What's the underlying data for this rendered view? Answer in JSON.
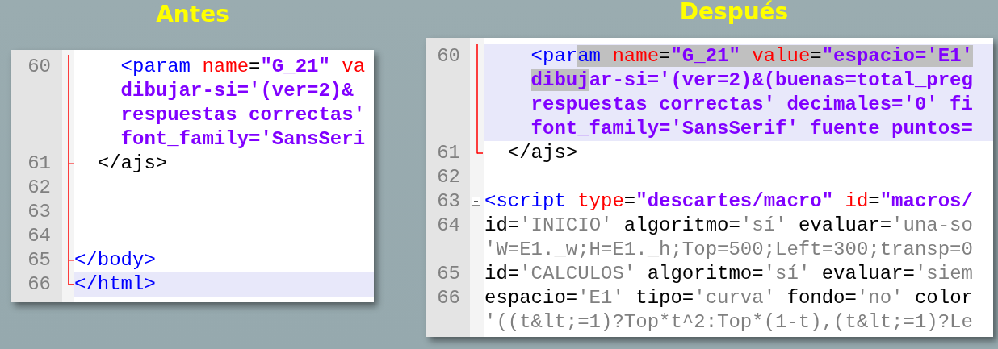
{
  "panels": [
    {
      "title": "Antes",
      "lines": [
        {
          "number": "60",
          "kind": "bar",
          "highlighted": false,
          "rows": [
            [
              {
                "kind": "tag",
                "text": "    <param ",
                "selected": false
              },
              {
                "kind": "attr",
                "text": "name",
                "selected": false
              },
              {
                "kind": "eq",
                "text": "=",
                "selected": false
              },
              {
                "kind": "string",
                "text": "\"G_21\"",
                "selected": false
              },
              {
                "kind": "attr",
                "text": " va",
                "selected": false
              }
            ],
            [
              {
                "kind": "string",
                "text": "    dibujar-si='(ver=2)&",
                "selected": false
              }
            ],
            [
              {
                "kind": "string",
                "text": "    respuestas correctas'",
                "selected": false
              }
            ],
            [
              {
                "kind": "string",
                "text": "    font_family='SansSeri",
                "selected": false
              }
            ]
          ]
        },
        {
          "number": "61",
          "kind": "tick",
          "highlighted": false,
          "rows": [
            [
              {
                "kind": "text",
                "text": "  </ajs>",
                "selected": false
              }
            ]
          ]
        },
        {
          "number": "62",
          "kind": "bar",
          "highlighted": false
        },
        {
          "number": "63",
          "kind": "bar",
          "highlighted": false
        },
        {
          "number": "64",
          "kind": "bar",
          "highlighted": false
        },
        {
          "number": "65",
          "kind": "tick",
          "highlighted": false,
          "rows": [
            [
              {
                "kind": "tag",
                "text": "</body>",
                "selected": false
              }
            ]
          ]
        },
        {
          "number": "66",
          "kind": "end",
          "highlighted": true,
          "rows": [
            [
              {
                "kind": "tag",
                "text": "</html>",
                "selected": false
              }
            ]
          ]
        }
      ]
    },
    {
      "title": "Después",
      "lines": [
        {
          "number": "60",
          "kind": "bar",
          "highlighted": true,
          "rows": [
            [
              {
                "kind": "tag",
                "text": "    <par",
                "selected": false
              },
              {
                "kind": "tag",
                "text": "am ",
                "selected": true
              },
              {
                "kind": "attr",
                "text": "name",
                "selected": true
              },
              {
                "kind": "eq",
                "text": "=",
                "selected": true
              },
              {
                "kind": "string",
                "text": "\"G_21\"",
                "selected": true
              },
              {
                "kind": "attr",
                "text": " value",
                "selected": true
              },
              {
                "kind": "eq",
                "text": "=",
                "selected": true
              },
              {
                "kind": "string",
                "text": "\"espacio='E1'",
                "selected": true
              }
            ],
            [
              {
                "kind": "string",
                "text": "    ",
                "selected": false
              },
              {
                "kind": "string",
                "text": "dibuj",
                "selected": true
              },
              {
                "kind": "string",
                "text": "ar-si='(ver=2)&(buenas=total_preg",
                "selected": false
              }
            ],
            [
              {
                "kind": "string",
                "text": "    respuestas correctas' decimales='0' fi",
                "selected": false
              }
            ],
            [
              {
                "kind": "string",
                "text": "    font_family='SansSerif' fuente puntos=",
                "selected": false
              }
            ]
          ]
        },
        {
          "number": "61",
          "kind": "end",
          "highlighted": false,
          "rows": [
            [
              {
                "kind": "text",
                "text": "  </ajs>",
                "selected": false
              }
            ]
          ]
        },
        {
          "number": "62",
          "kind": "plain",
          "highlighted": false
        },
        {
          "number": "63",
          "kind": "box",
          "highlighted": false,
          "rows": [
            [
              {
                "kind": "tag",
                "text": "<script ",
                "selected": false
              },
              {
                "kind": "attr",
                "text": "type",
                "selected": false
              },
              {
                "kind": "eq",
                "text": "=",
                "selected": false
              },
              {
                "kind": "string",
                "text": "\"descartes/macro\"",
                "selected": false
              },
              {
                "kind": "attr",
                "text": " id",
                "selected": false
              },
              {
                "kind": "eq",
                "text": "=",
                "selected": false
              },
              {
                "kind": "string",
                "text": "\"macros/",
                "selected": false
              }
            ]
          ]
        },
        {
          "number": "64",
          "kind": "plain",
          "highlighted": false,
          "rows": [
            [
              {
                "kind": "text",
                "text": "id=",
                "selected": false
              },
              {
                "kind": "value",
                "text": "'INICIO'",
                "selected": false
              },
              {
                "kind": "text",
                "text": " algoritmo=",
                "selected": false
              },
              {
                "kind": "value",
                "text": "'sí'",
                "selected": false
              },
              {
                "kind": "text",
                "text": " evaluar=",
                "selected": false
              },
              {
                "kind": "value",
                "text": "'una-so",
                "selected": false
              }
            ],
            [
              {
                "kind": "value",
                "text": "'W=E1._w;H=E1._h;Top=500;Left=300;transp=0",
                "selected": false
              }
            ]
          ]
        },
        {
          "number": "65",
          "kind": "plain",
          "highlighted": false,
          "rows": [
            [
              {
                "kind": "text",
                "text": "id=",
                "selected": false
              },
              {
                "kind": "value",
                "text": "'CALCULOS'",
                "selected": false
              },
              {
                "kind": "text",
                "text": " algoritmo=",
                "selected": false
              },
              {
                "kind": "value",
                "text": "'sí'",
                "selected": false
              },
              {
                "kind": "text",
                "text": " evaluar=",
                "selected": false
              },
              {
                "kind": "value",
                "text": "'siem",
                "selected": false
              }
            ]
          ]
        },
        {
          "number": "66",
          "kind": "plain",
          "highlighted": false,
          "rows": [
            [
              {
                "kind": "text",
                "text": "espacio=",
                "selected": false
              },
              {
                "kind": "value",
                "text": "'E1'",
                "selected": false
              },
              {
                "kind": "text",
                "text": " tipo=",
                "selected": false
              },
              {
                "kind": "value",
                "text": "'curva'",
                "selected": false
              },
              {
                "kind": "text",
                "text": " fondo=",
                "selected": false
              },
              {
                "kind": "value",
                "text": "'no'",
                "selected": false
              },
              {
                "kind": "text",
                "text": " color",
                "selected": false
              }
            ],
            [
              {
                "kind": "value",
                "text": "'((t&lt;=1)?Top*t^2:Top*(1-t),(t&lt;=1)?Le",
                "selected": false
              }
            ]
          ]
        }
      ]
    }
  ]
}
